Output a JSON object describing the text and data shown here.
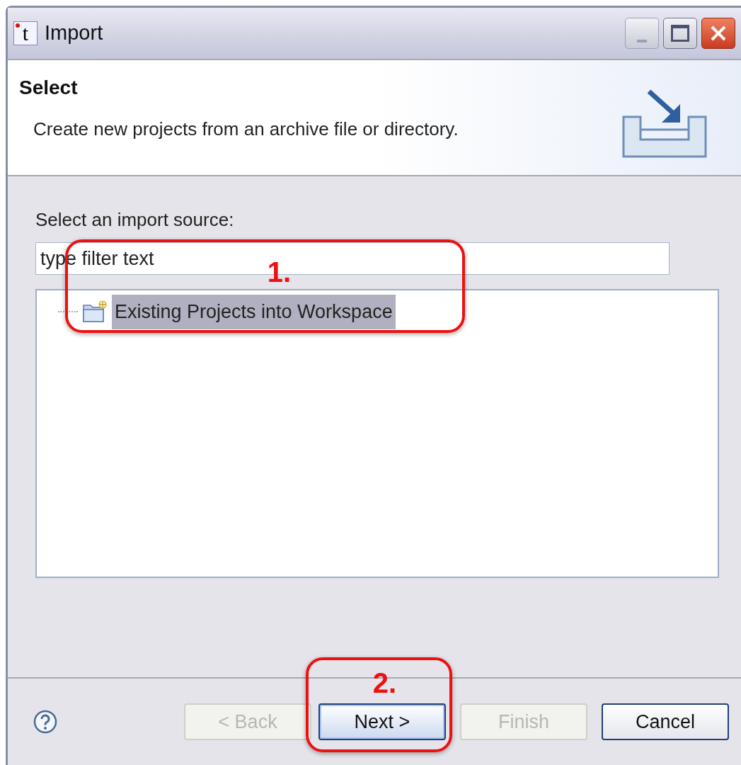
{
  "window": {
    "icon_letter": "t",
    "title": "Import"
  },
  "header": {
    "title": "Select",
    "description": "Create new projects from an archive file or directory."
  },
  "source_label": "Select an import source:",
  "filter": {
    "value": "type filter text"
  },
  "tree": {
    "items": [
      {
        "label": "Existing Projects into Workspace",
        "selected": true
      }
    ]
  },
  "buttons": [
    {
      "label": "< Back",
      "disabled": true,
      "focused": false
    },
    {
      "label": "Next >",
      "disabled": false,
      "focused": true
    },
    {
      "label": "Finish",
      "disabled": true,
      "focused": false
    },
    {
      "label": "Cancel",
      "disabled": false,
      "focused": false
    }
  ],
  "annotations": [
    {
      "label": "1."
    },
    {
      "label": "2."
    }
  ]
}
